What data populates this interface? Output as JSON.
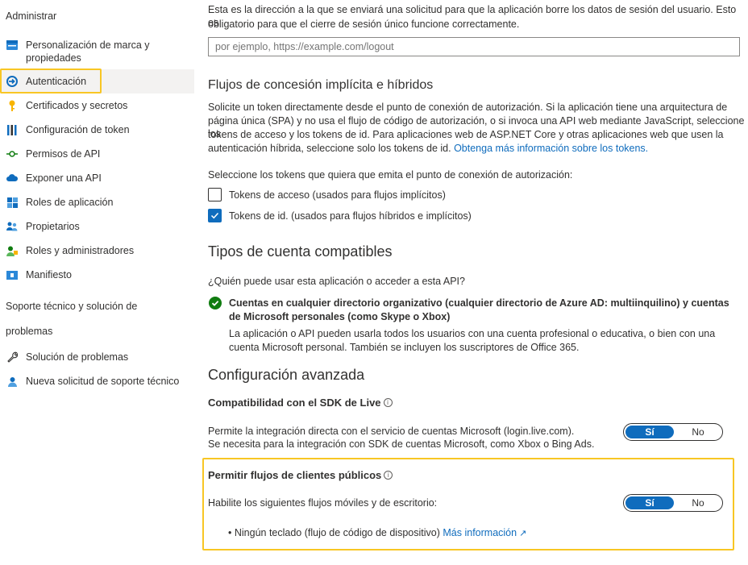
{
  "sidebar": {
    "section_admin": "Administrar",
    "items": [
      {
        "label": "Personalización de marca y",
        "label2": "propiedades",
        "icon": "branding-icon"
      },
      {
        "label": "Autenticación",
        "icon": "authentication-icon"
      },
      {
        "label": "Certificados y secretos",
        "icon": "key-icon"
      },
      {
        "label": "Configuración de token",
        "icon": "token-config-icon"
      },
      {
        "label": "Permisos de API",
        "icon": "api-permissions-icon"
      },
      {
        "label": "Exponer una API",
        "icon": "cloud-icon"
      },
      {
        "label": "Roles de aplicación",
        "icon": "app-roles-icon"
      },
      {
        "label": "Propietarios",
        "icon": "owners-icon"
      },
      {
        "label": "Roles y administradores",
        "icon": "roles-admins-icon"
      },
      {
        "label": "Manifiesto",
        "icon": "manifest-icon"
      }
    ],
    "section_support_1": "Soporte técnico y solución de",
    "section_support_2": "problemas",
    "support_items": [
      {
        "label": "Solución de problemas",
        "icon": "wrench-icon"
      },
      {
        "label": "Nueva solicitud de soporte técnico",
        "icon": "support-person-icon"
      }
    ]
  },
  "logout": {
    "description_1": "Esta es la dirección a la que se enviará una solicitud para que la aplicación borre los datos de sesión del usuario. Esto es",
    "description_2": "obligatorio para que el cierre de sesión único funcione correctamente.",
    "placeholder": "por ejemplo, https://example.com/logout"
  },
  "implicit": {
    "heading": "Flujos de concesión implícita e híbridos",
    "para_1": "Solicite un token directamente desde el punto de conexión de autorización. Si la aplicación tiene una arquitectura de",
    "para_2": "página única (SPA) y no usa el flujo de código de autorización, o si invoca una API web mediante JavaScript, seleccione los",
    "para_3": "tokens de acceso y los tokens de id. Para aplicaciones web de ASP.NET Core y otras aplicaciones web que usen la",
    "para_4": "autenticación híbrida, seleccione solo los tokens de id.",
    "para_link": "Obtenga más información sobre los tokens.",
    "select_prompt": "Seleccione los tokens que quiera que emita el punto de conexión de autorización:",
    "access_tokens_label": "Tokens de acceso (usados para flujos implícitos)",
    "access_tokens_checked": false,
    "id_tokens_label": "Tokens de id. (usados para flujos híbridos e implícitos)",
    "id_tokens_checked": true
  },
  "account_types": {
    "heading": "Tipos de cuenta compatibles",
    "question": "¿Quién puede usar esta aplicación o acceder a esta API?",
    "option_bold_1": "Cuentas en cualquier directorio organizativo (cualquier directorio de Azure AD: multiinquilino) y cuentas",
    "option_bold_2": "de Microsoft personales (como Skype o Xbox)",
    "option_desc_1": "La aplicación o API pueden usarla todos los usuarios con una cuenta profesional o educativa, o bien con una",
    "option_desc_2": "cuenta Microsoft personal. También se incluyen los suscriptores de Office 365."
  },
  "advanced": {
    "heading": "Configuración avanzada",
    "live_sdk_title": "Compatibilidad con el SDK de Live",
    "live_sdk_desc_1": "Permite la integración directa con el servicio de cuentas Microsoft (login.live.com).",
    "live_sdk_desc_2": "Se necesita para la integración con SDK de cuentas Microsoft, como Xbox o Bing Ads.",
    "public_title": "Permitir flujos de clientes públicos",
    "public_desc": "Habilite los siguientes flujos móviles y de escritorio:",
    "bullet_text": "Ningún teclado (flujo de código de dispositivo)",
    "bullet_link": "Más información",
    "toggle_yes": "Sí",
    "toggle_no": "No"
  },
  "colors": {
    "accent": "#0f6cbd",
    "highlight": "#f8c624",
    "success": "#107c10"
  }
}
